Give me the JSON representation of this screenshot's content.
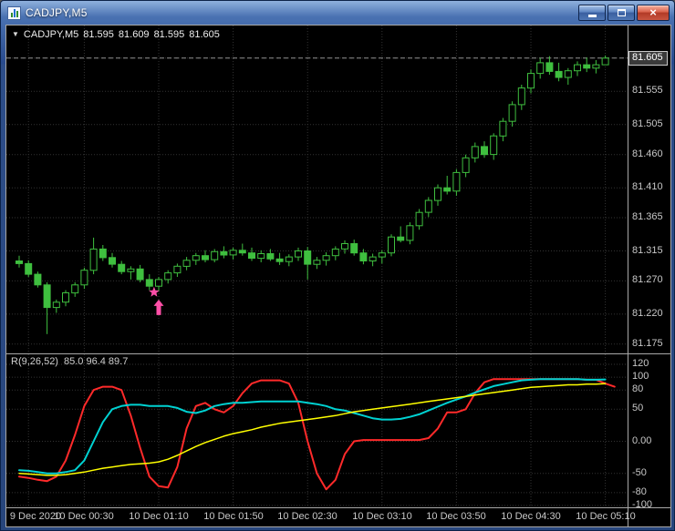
{
  "window": {
    "title": "CADJPY,M5",
    "controls": {
      "minimize": "minimize",
      "maximize": "maximize",
      "close": "close"
    }
  },
  "main_header": {
    "dropdown_glyph": "▼",
    "symbol": "CADJPY,M5",
    "open": "81.595",
    "high": "81.609",
    "low": "81.595",
    "close": "81.605"
  },
  "indicator_header": {
    "name": "R(9,26,52)",
    "values": "85.0 96.4 89.7"
  },
  "price_scale": {
    "current_label": "81.605"
  },
  "colors": {
    "candle": "#3fbf3f",
    "bull_fill": "#000000",
    "grid": "#333333",
    "bid_line": "#8f8f8f",
    "axis_text": "#c8c8c8",
    "marker": "#ff4fa7",
    "red_line": "#ff2a2a",
    "cyan_line": "#00d2d2",
    "yellow_line": "#ffff00"
  },
  "chart_data": {
    "type": "candlestick",
    "title": "CADJPY,M5",
    "x_ticks": [
      {
        "label": "9 Dec 2020",
        "i": 1
      },
      {
        "label": "10 Dec 00:30",
        "i": 7
      },
      {
        "label": "10 Dec 01:10",
        "i": 15
      },
      {
        "label": "10 Dec 01:50",
        "i": 23
      },
      {
        "label": "10 Dec 02:30",
        "i": 31
      },
      {
        "label": "10 Dec 03:10",
        "i": 39
      },
      {
        "label": "10 Dec 03:50",
        "i": 47
      },
      {
        "label": "10 Dec 04:30",
        "i": 55
      },
      {
        "label": "10 Dec 05:10",
        "i": 63
      }
    ],
    "panels": [
      {
        "name": "price",
        "type": "candlestick",
        "ylim": [
          81.161,
          81.654
        ],
        "current_price": 81.605,
        "y_ticks": [
          {
            "label": "81.605",
            "v": 81.605
          },
          {
            "label": "81.555",
            "v": 81.555
          },
          {
            "label": "81.505",
            "v": 81.505
          },
          {
            "label": "81.460",
            "v": 81.46
          },
          {
            "label": "81.410",
            "v": 81.41
          },
          {
            "label": "81.365",
            "v": 81.365
          },
          {
            "label": "81.315",
            "v": 81.315
          },
          {
            "label": "81.270",
            "v": 81.27
          },
          {
            "label": "81.220",
            "v": 81.22
          },
          {
            "label": "81.175",
            "v": 81.175
          }
        ],
        "markers": [
          {
            "shape": "star",
            "i": 14.5,
            "price": 81.253
          },
          {
            "shape": "arrow-up",
            "i": 15,
            "price": 81.242
          }
        ],
        "ohlc": [
          [
            81.3,
            81.308,
            81.29,
            81.296
          ],
          [
            81.296,
            81.301,
            81.276,
            81.28
          ],
          [
            81.28,
            81.284,
            81.26,
            81.264
          ],
          [
            81.264,
            81.268,
            81.19,
            81.23
          ],
          [
            81.23,
            81.242,
            81.222,
            81.238
          ],
          [
            81.238,
            81.256,
            81.232,
            81.252
          ],
          [
            81.252,
            81.268,
            81.246,
            81.264
          ],
          [
            81.264,
            81.29,
            81.258,
            81.286
          ],
          [
            81.286,
            81.335,
            81.28,
            81.318
          ],
          [
            81.318,
            81.324,
            81.3,
            81.305
          ],
          [
            81.305,
            81.312,
            81.29,
            81.295
          ],
          [
            81.295,
            81.3,
            81.28,
            81.284
          ],
          [
            81.284,
            81.292,
            81.272,
            81.288
          ],
          [
            81.288,
            81.294,
            81.268,
            81.272
          ],
          [
            81.272,
            81.28,
            81.256,
            81.262
          ],
          [
            81.262,
            81.276,
            81.254,
            81.272
          ],
          [
            81.272,
            81.286,
            81.266,
            81.282
          ],
          [
            81.282,
            81.296,
            81.276,
            81.292
          ],
          [
            81.292,
            81.306,
            81.286,
            81.301
          ],
          [
            81.301,
            81.312,
            81.294,
            81.308
          ],
          [
            81.308,
            81.316,
            81.298,
            81.302
          ],
          [
            81.302,
            81.318,
            81.298,
            81.314
          ],
          [
            81.314,
            81.322,
            81.304,
            81.309
          ],
          [
            81.309,
            81.32,
            81.302,
            81.316
          ],
          [
            81.316,
            81.326,
            81.308,
            81.312
          ],
          [
            81.312,
            81.32,
            81.3,
            81.304
          ],
          [
            81.304,
            81.316,
            81.298,
            81.311
          ],
          [
            81.311,
            81.318,
            81.3,
            81.303
          ],
          [
            81.303,
            81.312,
            81.294,
            81.299
          ],
          [
            81.299,
            81.31,
            81.292,
            81.306
          ],
          [
            81.306,
            81.32,
            81.3,
            81.315
          ],
          [
            81.315,
            81.321,
            81.272,
            81.295
          ],
          [
            81.295,
            81.306,
            81.288,
            81.301
          ],
          [
            81.301,
            81.313,
            81.293,
            81.308
          ],
          [
            81.308,
            81.322,
            81.301,
            81.318
          ],
          [
            81.318,
            81.331,
            81.311,
            81.326
          ],
          [
            81.326,
            81.332,
            81.308,
            81.312
          ],
          [
            81.312,
            81.318,
            81.295,
            81.3
          ],
          [
            81.3,
            81.311,
            81.292,
            81.306
          ],
          [
            81.306,
            81.316,
            81.296,
            81.312
          ],
          [
            81.312,
            81.34,
            81.307,
            81.336
          ],
          [
            81.336,
            81.352,
            81.328,
            81.331
          ],
          [
            81.331,
            81.358,
            81.325,
            81.353
          ],
          [
            81.353,
            81.378,
            81.347,
            81.373
          ],
          [
            81.373,
            81.396,
            81.366,
            81.391
          ],
          [
            81.391,
            81.415,
            81.383,
            81.41
          ],
          [
            81.41,
            81.428,
            81.4,
            81.405
          ],
          [
            81.405,
            81.438,
            81.398,
            81.433
          ],
          [
            81.433,
            81.46,
            81.426,
            81.455
          ],
          [
            81.455,
            81.478,
            81.448,
            81.472
          ],
          [
            81.472,
            81.48,
            81.455,
            81.46
          ],
          [
            81.46,
            81.492,
            81.452,
            81.488
          ],
          [
            81.488,
            81.515,
            81.48,
            81.51
          ],
          [
            81.51,
            81.54,
            81.502,
            81.535
          ],
          [
            81.535,
            81.565,
            81.527,
            81.56
          ],
          [
            81.56,
            81.588,
            81.552,
            81.582
          ],
          [
            81.582,
            81.605,
            81.574,
            81.598
          ],
          [
            81.598,
            81.608,
            81.58,
            81.585
          ],
          [
            81.585,
            81.598,
            81.57,
            81.576
          ],
          [
            81.576,
            81.59,
            81.565,
            81.586
          ],
          [
            81.586,
            81.6,
            81.578,
            81.595
          ],
          [
            81.595,
            81.606,
            81.584,
            81.59
          ],
          [
            81.59,
            81.602,
            81.582,
            81.595
          ],
          [
            81.595,
            81.609,
            81.595,
            81.605
          ]
        ]
      },
      {
        "name": "oscillator",
        "type": "line",
        "label": "R(9,26,52)",
        "display_values": "85.0 96.4 89.7",
        "ylim": [
          -102.9,
          135.6
        ],
        "y_ticks": [
          {
            "label": "120",
            "v": 120
          },
          {
            "label": "100",
            "v": 100
          },
          {
            "label": "80",
            "v": 80
          },
          {
            "label": "50",
            "v": 50
          },
          {
            "label": "0.00",
            "v": 0
          },
          {
            "label": "-50",
            "v": -50
          },
          {
            "label": "-80",
            "v": -80
          },
          {
            "label": "-100",
            "v": -100
          }
        ],
        "series": [
          {
            "name": "red",
            "color": "#ff2a2a",
            "values": [
              -55,
              -57,
              -60,
              -62,
              -55,
              -30,
              10,
              55,
              80,
              85,
              85,
              80,
              40,
              -10,
              -55,
              -70,
              -72,
              -40,
              20,
              55,
              60,
              50,
              45,
              55,
              75,
              90,
              95,
              95,
              95,
              90,
              60,
              0,
              -50,
              -75,
              -60,
              -20,
              0,
              2,
              2,
              2,
              2,
              2,
              2,
              2,
              5,
              20,
              45,
              45,
              50,
              75,
              92,
              97,
              97,
              97,
              97,
              97,
              97,
              97,
              97,
              97,
              97,
              96,
              96,
              90,
              85
            ]
          },
          {
            "name": "cyan",
            "color": "#00d2d2",
            "values": [
              -45,
              -46,
              -48,
              -50,
              -50,
              -48,
              -45,
              -30,
              0,
              30,
              50,
              55,
              57,
              57,
              55,
              55,
              55,
              52,
              46,
              44,
              48,
              55,
              58,
              60,
              60,
              61,
              62,
              62,
              62,
              62,
              62,
              60,
              58,
              55,
              50,
              48,
              44,
              40,
              36,
              34,
              34,
              35,
              38,
              42,
              48,
              54,
              60,
              65,
              70,
              76,
              81,
              86,
              89,
              92,
              95,
              96,
              97,
              97,
              97,
              97,
              97,
              96,
              96,
              96.4
            ]
          },
          {
            "name": "yellow",
            "color": "#ffff00",
            "values": [
              -50,
              -51,
              -52,
              -53,
              -53,
              -52,
              -50,
              -48,
              -45,
              -42,
              -40,
              -38,
              -36,
              -35,
              -34,
              -32,
              -28,
              -22,
              -15,
              -8,
              -2,
              3,
              8,
              12,
              15,
              18,
              22,
              25,
              28,
              30,
              32,
              34,
              36,
              38,
              40,
              43,
              46,
              48,
              50,
              52,
              54,
              56,
              58,
              60,
              62,
              64,
              66,
              68,
              70,
              72,
              74,
              76,
              78,
              80,
              82,
              84,
              85,
              86,
              87,
              88,
              88,
              89,
              89,
              89.7
            ]
          }
        ]
      }
    ]
  }
}
